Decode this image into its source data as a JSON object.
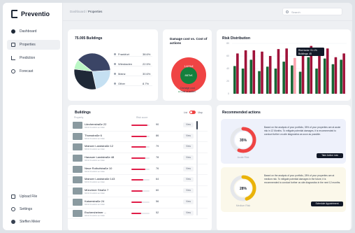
{
  "app": {
    "name": "Preventio"
  },
  "sidebar": {
    "items": [
      {
        "label": "Dashboard",
        "icon": "dashboard-icon"
      },
      {
        "label": "Properties",
        "icon": "home-icon"
      },
      {
        "label": "Prediction",
        "icon": "trend-icon"
      },
      {
        "label": "Forecast",
        "icon": "forecast-icon"
      }
    ],
    "bottom": [
      {
        "label": "Upload File",
        "icon": "upload-icon"
      },
      {
        "label": "Settings",
        "icon": "gear-icon"
      },
      {
        "label": "Steffen Meier",
        "icon": "avatar"
      }
    ]
  },
  "topbar": {
    "crumb_root": "Dashboard",
    "crumb_sep": "/",
    "crumb_current": "Properties",
    "search_placeholder": "Search"
  },
  "buildings_card": {
    "title": "75.005 Buildings"
  },
  "damage_card": {
    "title": "Damage cost vs. Cost of actions"
  },
  "risk_card": {
    "title": "Risk Distribution"
  },
  "buildings_table": {
    "title": "Buildings",
    "toggle_left": "List",
    "toggle_right": "Map",
    "col_property": "Property",
    "col_risk": "Risk score"
  },
  "recommended": {
    "title": "Recommended actions",
    "items": [
      {
        "text": "Based on the analysis of your portfolio, 35% of your properties are at acute risk in 12 Months. To mitigate potential damages, it is recommended to conduct further on-site diagnostics as soon as possible.",
        "button": "Take Action now",
        "label": "Acute Risk"
      },
      {
        "text": "Based on the analysis of your portfolio, 28% of your properties are at medium risk. To mitigate potential damages in the future, it is recommended to conduct further on-site diagnostics in the next 12 months.",
        "button": "Schedule Appointment",
        "label": "Medium Risk"
      }
    ]
  },
  "chart_data": [
    {
      "type": "pie",
      "labels": [
        "Frankfurt",
        "Wiesbaden",
        "Mainz",
        "Other"
      ],
      "values": [
        38.6,
        22.5,
        30.6,
        8.7
      ],
      "value_labels": [
        "38.6%",
        "22.5%",
        "30.6%",
        "8.7%"
      ],
      "colors": [
        "#3b4566",
        "#c5e0f2",
        "#1f2937",
        "#bbf7c5"
      ],
      "legend": "right"
    },
    {
      "type": "bubble",
      "series": [
        {
          "name": "Damage cost",
          "value_label": "1427k€",
          "color": "#ef4444"
        },
        {
          "name": "Cost of action",
          "value_label": "887k€",
          "color": "#15803d"
        }
      ],
      "legend": "bottom"
    },
    {
      "type": "bar",
      "title": "Risk Distribution",
      "categories": [
        "1",
        "2",
        "3",
        "4",
        "5",
        "6",
        "7",
        "8",
        "9",
        "10",
        "11",
        "12",
        "13",
        "14"
      ],
      "series": [
        {
          "name": "Acute",
          "color": "#9f1239",
          "values": [
            64,
            69,
            69,
            67,
            60,
            71,
            72,
            57,
            66,
            76,
            65,
            72,
            58,
            64
          ]
        },
        {
          "name": "Medium",
          "color": "#166534",
          "values": [
            44,
            40,
            54,
            36,
            43,
            40,
            51,
            45,
            35,
            58,
            40,
            56,
            47,
            54
          ]
        }
      ],
      "ylim": [
        0,
        80
      ],
      "yticks": [
        "0",
        "20",
        "40",
        "60",
        "80"
      ],
      "tooltip": {
        "title": "Risk factor: 91.1%",
        "sub": "Buildings: 45"
      },
      "grid": true
    }
  ],
  "buildings": [
    {
      "name": "Lärchenstraße 22",
      "sub": "60313 Frankfurt am Main",
      "score": 90,
      "button": "View"
    },
    {
      "name": "Thorsstraße 6",
      "sub": "60313 Frankfurt am Main",
      "score": 86,
      "button": "View"
    },
    {
      "name": "Mainzer Landstraße 12",
      "sub": "60313 Frankfurt am Main",
      "score": 79,
      "button": "View"
    },
    {
      "name": "Hanauer Landstraße 48",
      "sub": "60313 Frankfurt am Main",
      "score": 78,
      "button": "View"
    },
    {
      "name": "Neue Rothofstraße 10",
      "sub": "60313 Frankfurt am Main",
      "score": 76,
      "button": "View"
    },
    {
      "name": "Mainzer Landstraße 143",
      "sub": "60313 Frankfurt am Main",
      "score": 64,
      "button": "View"
    },
    {
      "name": "Münchner Straße 7",
      "sub": "60313 Frankfurt am Main",
      "score": 60,
      "button": "View"
    },
    {
      "name": "Kaiserstraße 24",
      "sub": "60313 Frankfurt am Main",
      "score": 56,
      "button": "View"
    },
    {
      "name": "Eschersheimer ...",
      "sub": "60313 Frankfurt am Main",
      "score": 52,
      "button": "View"
    }
  ],
  "gauges": [
    {
      "percent": 35,
      "label": "35%",
      "color": "#ef4444"
    },
    {
      "percent": 28,
      "label": "28%",
      "color": "#eab308"
    }
  ]
}
